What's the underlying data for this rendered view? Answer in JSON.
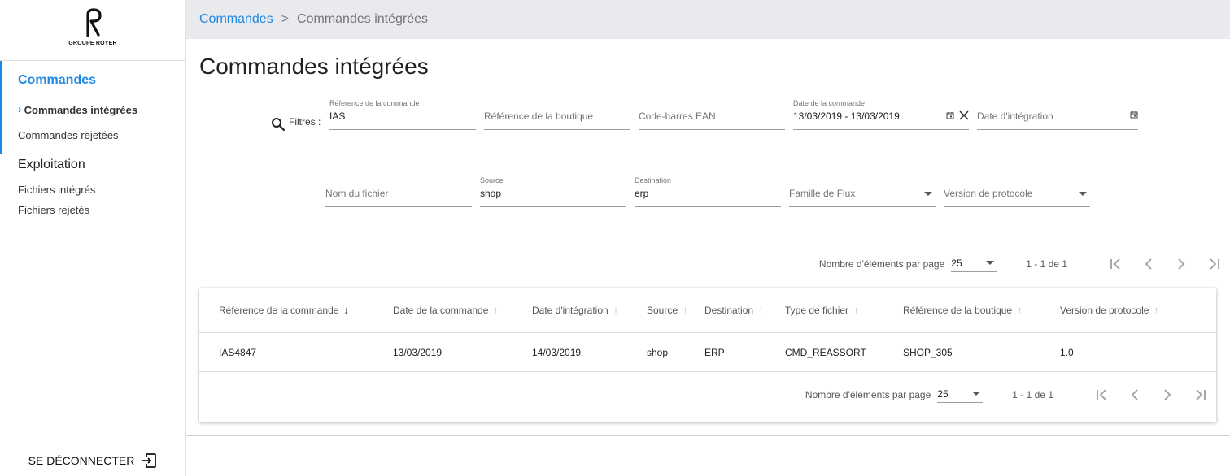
{
  "brand": {
    "name": "GROUPE ROYER"
  },
  "sidebar": {
    "sections": [
      {
        "title": "Commandes",
        "items": [
          "Commandes intégrées",
          "Commandes rejetées"
        ]
      },
      {
        "title": "Exploitation",
        "items": [
          "Fichiers intégrés",
          "Fichiers rejetés"
        ]
      }
    ],
    "logout": "SE DÉCONNECTER"
  },
  "header": {
    "crumb_parent": "Commandes",
    "separator": ">",
    "crumb_current": "Commandes intégrées"
  },
  "page": {
    "title": "Commandes intégrées"
  },
  "filters": {
    "label": "Filtres :",
    "ref_commande": {
      "label": "Réference de la commande",
      "value": "IAS"
    },
    "ref_boutique": {
      "placeholder": "Référence de la boutique"
    },
    "ean": {
      "placeholder": "Code-barres EAN"
    },
    "date_commande": {
      "label": "Date de la commande",
      "value": "13/03/2019 - 13/03/2019"
    },
    "date_integration": {
      "placeholder": "Date d'intégration"
    },
    "nom_fichier": {
      "placeholder": "Nom du fichier"
    },
    "source": {
      "label": "Source",
      "value": "shop"
    },
    "destination": {
      "label": "Destination",
      "value": "erp"
    },
    "famille": {
      "placeholder": "Famille de Flux"
    },
    "version": {
      "placeholder": "Version de protocole"
    }
  },
  "pagination": {
    "label": "Nombre d'éléments par page",
    "page_size": "25",
    "range": "1 - 1 de 1"
  },
  "table": {
    "columns": [
      "Réference de la commande",
      "Date de la commande",
      "Date d'intégration",
      "Source",
      "Destination",
      "Type de fichier",
      "Référence de la boutique",
      "Version de protocole"
    ],
    "sort_arrows": [
      "↓",
      "↑",
      "↑",
      "↑",
      "↑",
      "↑",
      "↑",
      "↑"
    ],
    "rows": [
      [
        "IAS4847",
        "13/03/2019",
        "14/03/2019",
        "shop",
        "ERP",
        "CMD_REASSORT",
        "SHOP_305",
        "1.0"
      ]
    ]
  },
  "colors": {
    "accent": "#1e88e5",
    "header_bg": "#e8eaed"
  }
}
